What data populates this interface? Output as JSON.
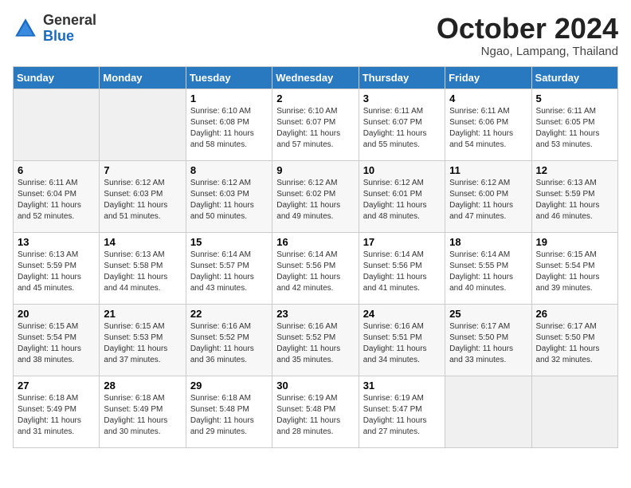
{
  "header": {
    "logo_general": "General",
    "logo_blue": "Blue",
    "month_title": "October 2024",
    "location": "Ngao, Lampang, Thailand"
  },
  "weekdays": [
    "Sunday",
    "Monday",
    "Tuesday",
    "Wednesday",
    "Thursday",
    "Friday",
    "Saturday"
  ],
  "weeks": [
    [
      {
        "day": "",
        "sunrise": "",
        "sunset": "",
        "daylight": ""
      },
      {
        "day": "",
        "sunrise": "",
        "sunset": "",
        "daylight": ""
      },
      {
        "day": "1",
        "sunrise": "Sunrise: 6:10 AM",
        "sunset": "Sunset: 6:08 PM",
        "daylight": "Daylight: 11 hours and 58 minutes."
      },
      {
        "day": "2",
        "sunrise": "Sunrise: 6:10 AM",
        "sunset": "Sunset: 6:07 PM",
        "daylight": "Daylight: 11 hours and 57 minutes."
      },
      {
        "day": "3",
        "sunrise": "Sunrise: 6:11 AM",
        "sunset": "Sunset: 6:07 PM",
        "daylight": "Daylight: 11 hours and 55 minutes."
      },
      {
        "day": "4",
        "sunrise": "Sunrise: 6:11 AM",
        "sunset": "Sunset: 6:06 PM",
        "daylight": "Daylight: 11 hours and 54 minutes."
      },
      {
        "day": "5",
        "sunrise": "Sunrise: 6:11 AM",
        "sunset": "Sunset: 6:05 PM",
        "daylight": "Daylight: 11 hours and 53 minutes."
      }
    ],
    [
      {
        "day": "6",
        "sunrise": "Sunrise: 6:11 AM",
        "sunset": "Sunset: 6:04 PM",
        "daylight": "Daylight: 11 hours and 52 minutes."
      },
      {
        "day": "7",
        "sunrise": "Sunrise: 6:12 AM",
        "sunset": "Sunset: 6:03 PM",
        "daylight": "Daylight: 11 hours and 51 minutes."
      },
      {
        "day": "8",
        "sunrise": "Sunrise: 6:12 AM",
        "sunset": "Sunset: 6:03 PM",
        "daylight": "Daylight: 11 hours and 50 minutes."
      },
      {
        "day": "9",
        "sunrise": "Sunrise: 6:12 AM",
        "sunset": "Sunset: 6:02 PM",
        "daylight": "Daylight: 11 hours and 49 minutes."
      },
      {
        "day": "10",
        "sunrise": "Sunrise: 6:12 AM",
        "sunset": "Sunset: 6:01 PM",
        "daylight": "Daylight: 11 hours and 48 minutes."
      },
      {
        "day": "11",
        "sunrise": "Sunrise: 6:12 AM",
        "sunset": "Sunset: 6:00 PM",
        "daylight": "Daylight: 11 hours and 47 minutes."
      },
      {
        "day": "12",
        "sunrise": "Sunrise: 6:13 AM",
        "sunset": "Sunset: 5:59 PM",
        "daylight": "Daylight: 11 hours and 46 minutes."
      }
    ],
    [
      {
        "day": "13",
        "sunrise": "Sunrise: 6:13 AM",
        "sunset": "Sunset: 5:59 PM",
        "daylight": "Daylight: 11 hours and 45 minutes."
      },
      {
        "day": "14",
        "sunrise": "Sunrise: 6:13 AM",
        "sunset": "Sunset: 5:58 PM",
        "daylight": "Daylight: 11 hours and 44 minutes."
      },
      {
        "day": "15",
        "sunrise": "Sunrise: 6:14 AM",
        "sunset": "Sunset: 5:57 PM",
        "daylight": "Daylight: 11 hours and 43 minutes."
      },
      {
        "day": "16",
        "sunrise": "Sunrise: 6:14 AM",
        "sunset": "Sunset: 5:56 PM",
        "daylight": "Daylight: 11 hours and 42 minutes."
      },
      {
        "day": "17",
        "sunrise": "Sunrise: 6:14 AM",
        "sunset": "Sunset: 5:56 PM",
        "daylight": "Daylight: 11 hours and 41 minutes."
      },
      {
        "day": "18",
        "sunrise": "Sunrise: 6:14 AM",
        "sunset": "Sunset: 5:55 PM",
        "daylight": "Daylight: 11 hours and 40 minutes."
      },
      {
        "day": "19",
        "sunrise": "Sunrise: 6:15 AM",
        "sunset": "Sunset: 5:54 PM",
        "daylight": "Daylight: 11 hours and 39 minutes."
      }
    ],
    [
      {
        "day": "20",
        "sunrise": "Sunrise: 6:15 AM",
        "sunset": "Sunset: 5:54 PM",
        "daylight": "Daylight: 11 hours and 38 minutes."
      },
      {
        "day": "21",
        "sunrise": "Sunrise: 6:15 AM",
        "sunset": "Sunset: 5:53 PM",
        "daylight": "Daylight: 11 hours and 37 minutes."
      },
      {
        "day": "22",
        "sunrise": "Sunrise: 6:16 AM",
        "sunset": "Sunset: 5:52 PM",
        "daylight": "Daylight: 11 hours and 36 minutes."
      },
      {
        "day": "23",
        "sunrise": "Sunrise: 6:16 AM",
        "sunset": "Sunset: 5:52 PM",
        "daylight": "Daylight: 11 hours and 35 minutes."
      },
      {
        "day": "24",
        "sunrise": "Sunrise: 6:16 AM",
        "sunset": "Sunset: 5:51 PM",
        "daylight": "Daylight: 11 hours and 34 minutes."
      },
      {
        "day": "25",
        "sunrise": "Sunrise: 6:17 AM",
        "sunset": "Sunset: 5:50 PM",
        "daylight": "Daylight: 11 hours and 33 minutes."
      },
      {
        "day": "26",
        "sunrise": "Sunrise: 6:17 AM",
        "sunset": "Sunset: 5:50 PM",
        "daylight": "Daylight: 11 hours and 32 minutes."
      }
    ],
    [
      {
        "day": "27",
        "sunrise": "Sunrise: 6:18 AM",
        "sunset": "Sunset: 5:49 PM",
        "daylight": "Daylight: 11 hours and 31 minutes."
      },
      {
        "day": "28",
        "sunrise": "Sunrise: 6:18 AM",
        "sunset": "Sunset: 5:49 PM",
        "daylight": "Daylight: 11 hours and 30 minutes."
      },
      {
        "day": "29",
        "sunrise": "Sunrise: 6:18 AM",
        "sunset": "Sunset: 5:48 PM",
        "daylight": "Daylight: 11 hours and 29 minutes."
      },
      {
        "day": "30",
        "sunrise": "Sunrise: 6:19 AM",
        "sunset": "Sunset: 5:48 PM",
        "daylight": "Daylight: 11 hours and 28 minutes."
      },
      {
        "day": "31",
        "sunrise": "Sunrise: 6:19 AM",
        "sunset": "Sunset: 5:47 PM",
        "daylight": "Daylight: 11 hours and 27 minutes."
      },
      {
        "day": "",
        "sunrise": "",
        "sunset": "",
        "daylight": ""
      },
      {
        "day": "",
        "sunrise": "",
        "sunset": "",
        "daylight": ""
      }
    ]
  ]
}
